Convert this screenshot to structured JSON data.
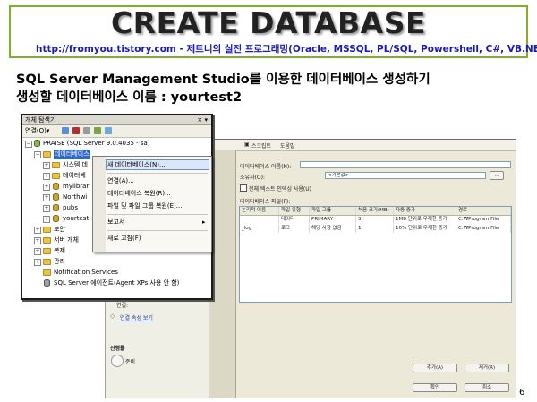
{
  "slide": {
    "title": "CREATE DATABASE",
    "subtitle": "http://fromyou.tistory.com - 제트니의 실전 프로그래밍(Oracle, MSSQL, PL/SQL, Powershell, C#, VB.NET)",
    "heading1": "SQL Server Management Studio를 이용한 데이터베이스 생성하기",
    "heading2": "생성할 데이터베이스 이름 : yourtest2",
    "page_number": "6"
  },
  "explorer": {
    "title": "개체 탐색기",
    "connect_label": "연결(O)▾",
    "tree": [
      {
        "label": "PRAISE (SQL Server 9.0.4035 - sa)"
      },
      {
        "label": "데이터베이스"
      },
      {
        "label": "시스템 데"
      },
      {
        "label": "데이터베"
      },
      {
        "label": "mylibrar"
      },
      {
        "label": "Northwi"
      },
      {
        "label": "pubs"
      },
      {
        "label": "yourtest"
      },
      {
        "label": "보안"
      },
      {
        "label": "서버 개체"
      },
      {
        "label": "복제"
      },
      {
        "label": "관리"
      },
      {
        "label": "Notification Services"
      },
      {
        "label": "SQL Server 에이전트(Agent XPs 사용 안 함)"
      }
    ]
  },
  "context_menu": {
    "items": [
      {
        "label": "새 데이터베이스(N)..."
      },
      {
        "label": "연결(A)..."
      },
      {
        "label": "데이터베이스 복원(R)..."
      },
      {
        "label": "파일 및 파일 그룹 복원(E)..."
      },
      {
        "label": "보고서"
      },
      {
        "label": "새로 고침(F)"
      }
    ],
    "submenu_arrow": "▸"
  },
  "dialog": {
    "toolbar_items": [
      "스크립트",
      "도움말"
    ],
    "db_name_label": "데이터베이스 이름(N):",
    "db_name_value": "",
    "owner_label": "소유자(O):",
    "owner_value": "<기본값>",
    "browse_label": "...",
    "fulltext_label": "전체 텍스트 인덱싱 사용(U)",
    "files_label": "데이터베이스 파일(F):",
    "grid": {
      "headers": [
        "논리적 이름",
        "파일 유형",
        "파일 그룹",
        "처음 크기(MB)",
        "자동 증가",
        "경로"
      ],
      "rows": [
        [
          "",
          "데이터",
          "PRIMARY",
          "3",
          "1MB 단위로 무제한 증가",
          "C:₩Program File"
        ],
        [
          "_log",
          "로그",
          "해당 사항 없음",
          "1",
          "10% 단위로 무제한 증가",
          "C:₩Program File"
        ]
      ]
    },
    "add_button": "추가(A)",
    "remove_button": "제거(R)",
    "ok_button": "확인",
    "cancel_button": "취소"
  },
  "lower_strip": {
    "connection_label": "연결:",
    "connection_props_link": "연결 속성 보기",
    "progress_label": "진행률",
    "ready_label": "준비"
  },
  "colors": {
    "header_border": "#7fb02a",
    "subtitle_text": "#1a1ab0",
    "menu_highlight": "#dde6f6",
    "folder": "#e8c24a"
  }
}
